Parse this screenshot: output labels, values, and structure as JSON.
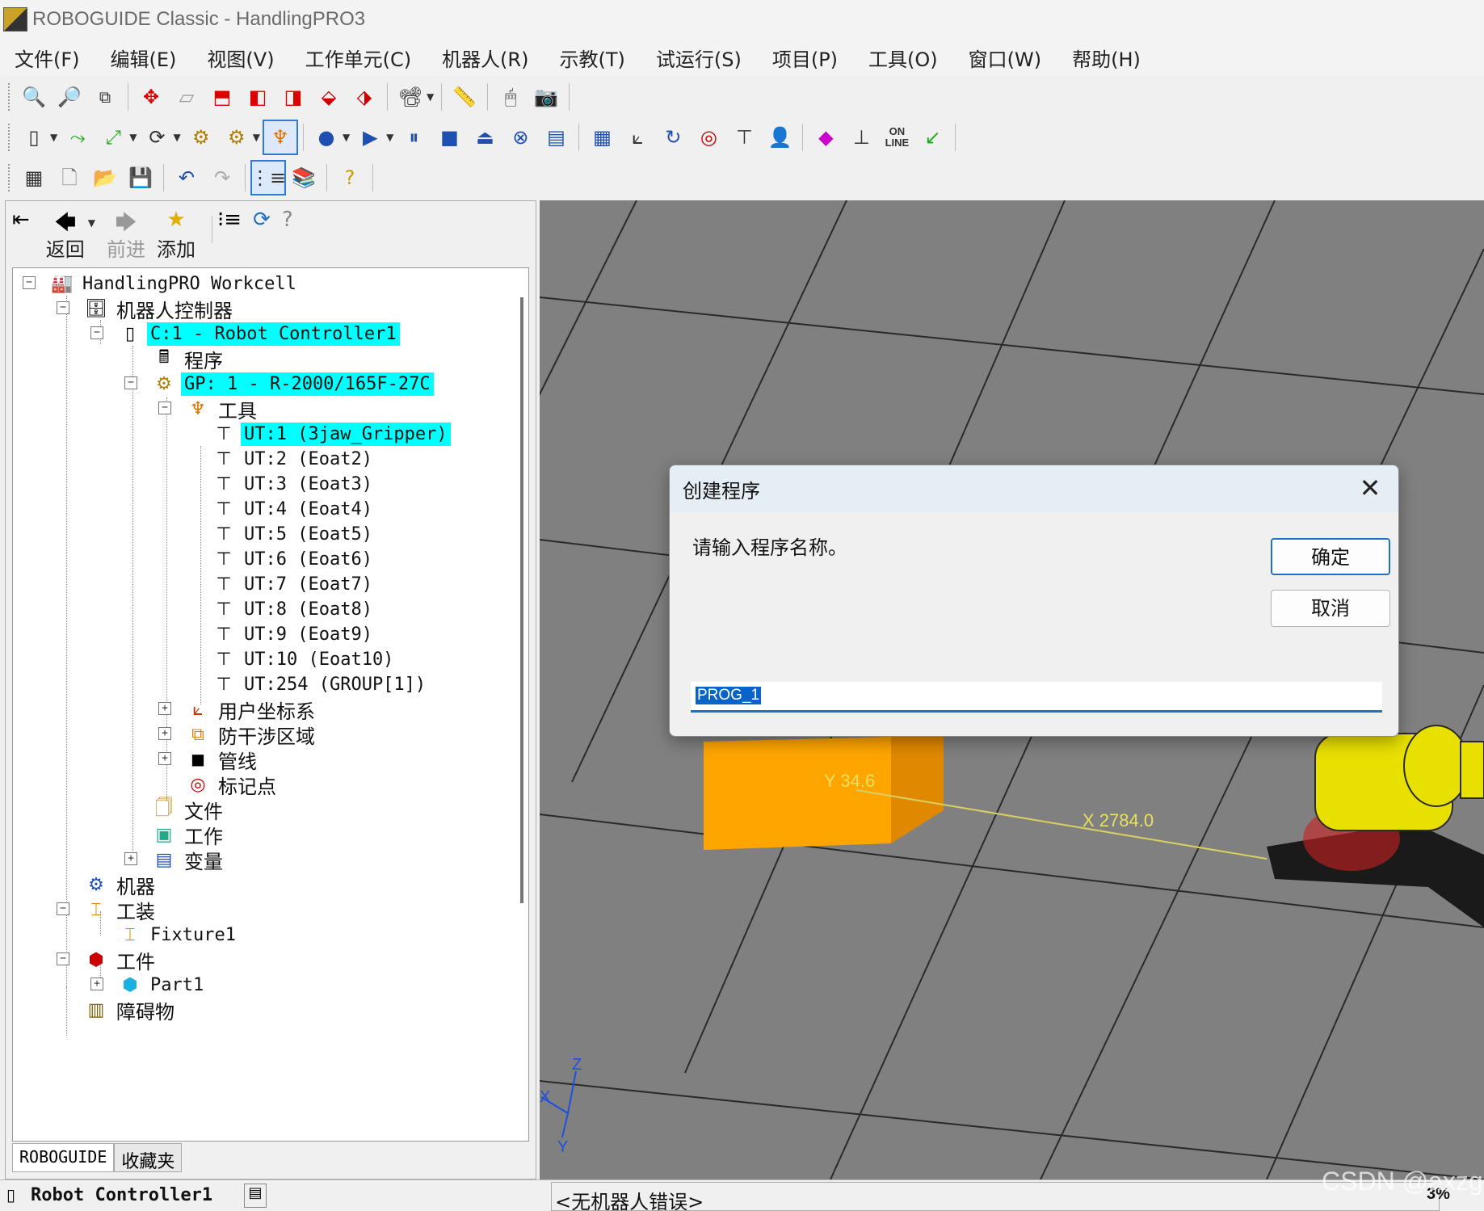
{
  "window": {
    "title": "ROBOGUIDE Classic - HandlingPRO3"
  },
  "menu": [
    "文件(F)",
    "编辑(E)",
    "视图(V)",
    "工作单元(C)",
    "机器人(R)",
    "示教(T)",
    "试运行(S)",
    "项目(P)",
    "工具(O)",
    "窗口(W)",
    "帮助(H)"
  ],
  "toolbar": {
    "online_line1": "ON",
    "online_line2": "LINE"
  },
  "nav": {
    "back": "返回",
    "forward": "前进",
    "add": "添加"
  },
  "tree": {
    "workcell": "HandlingPRO Workcell",
    "controllers": "机器人控制器",
    "controller1": "C:1 - Robot Controller1",
    "programs": "程序",
    "group1": "GP: 1 - R-2000/165F-27C",
    "tools": "工具",
    "tool_items": [
      "UT:1  (3jaw_Gripper)",
      "UT:2  (Eoat2)",
      "UT:3  (Eoat3)",
      "UT:4  (Eoat4)",
      "UT:5  (Eoat5)",
      "UT:6  (Eoat6)",
      "UT:7  (Eoat7)",
      "UT:8  (Eoat8)",
      "UT:9  (Eoat9)",
      "UT:10  (Eoat10)",
      "UT:254  (GROUP[1])"
    ],
    "user_frames": "用户坐标系",
    "interference": "防干涉区域",
    "cables": "管线",
    "markers": "标记点",
    "files": "文件",
    "jobs": "工作",
    "variables": "变量",
    "machines": "机器",
    "fixtures": "工装",
    "fixture1": "Fixture1",
    "parts": "工件",
    "part1": "Part1",
    "obstacles": "障碍物"
  },
  "bottom_tabs": [
    "ROBOGUIDE",
    "收藏夹"
  ],
  "viewport": {
    "y_label": "Y 34.6",
    "x_label": "X 2784.0",
    "axis_z": "Z",
    "axis_x": "X",
    "axis_y": "Y"
  },
  "dialog": {
    "title": "创建程序",
    "prompt": "请输入程序名称。",
    "ok": "确定",
    "cancel": "取消",
    "value": "PROG_1",
    "close": "✕"
  },
  "status": {
    "controller": "Robot Controller1",
    "message": "<无机器人错误>",
    "percent": "3%"
  },
  "watermark": "CSDN @axzg",
  "colors": {
    "highlight": "#00ffff",
    "accent": "#1f6fc6",
    "viewport_bg": "#808080",
    "part_orange": "#ffa500",
    "robot_yellow": "#e8e000"
  }
}
